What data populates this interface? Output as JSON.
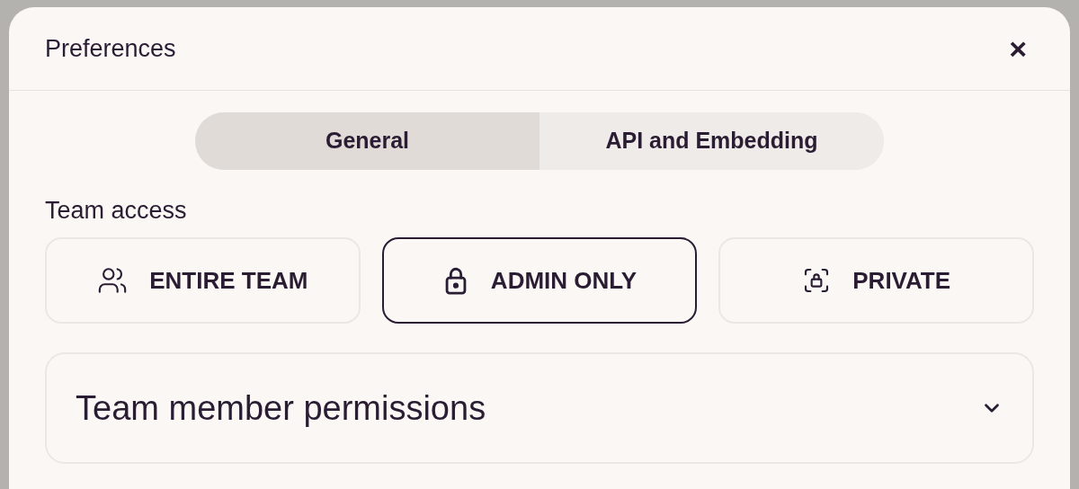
{
  "dialog": {
    "title": "Preferences",
    "close": "×"
  },
  "tabs": [
    {
      "label": "General",
      "selected": true
    },
    {
      "label": "API and Embedding",
      "selected": false
    }
  ],
  "team_access": {
    "label": "Team access",
    "options": [
      {
        "label": "ENTIRE TEAM",
        "selected": false
      },
      {
        "label": "ADMIN ONLY",
        "selected": true
      },
      {
        "label": "PRIVATE",
        "selected": false
      }
    ]
  },
  "section": {
    "title": "Team member permissions",
    "expanded": false
  }
}
